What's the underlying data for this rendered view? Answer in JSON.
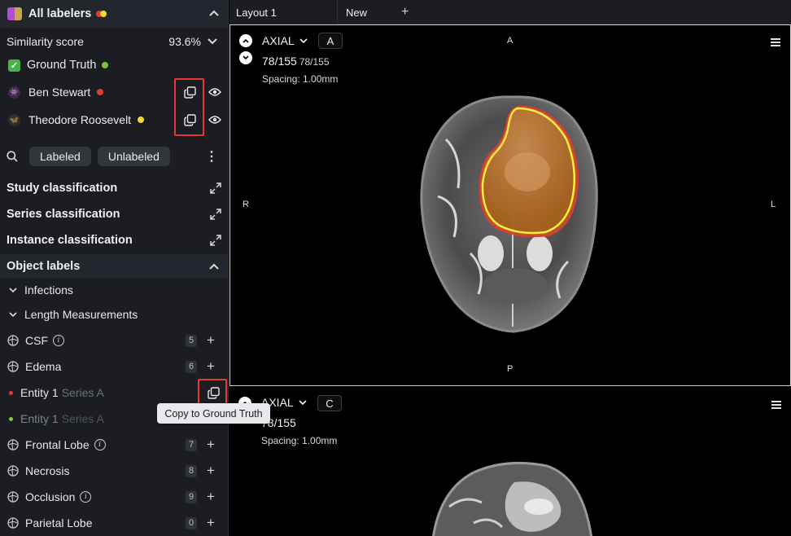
{
  "sidebar": {
    "header": {
      "title": "All labelers",
      "dot_colors": [
        "#e53935",
        "#fdd835"
      ]
    },
    "similarity": {
      "label": "Similarity score",
      "value": "93.6%"
    },
    "ground_truth": {
      "label": "Ground Truth",
      "dot_color": "#7cc242"
    },
    "labelers": [
      {
        "name": "Ben Stewart",
        "dot_color": "#e53935"
      },
      {
        "name": "Theodore Roosevelt",
        "dot_color": "#fdd835"
      }
    ],
    "filters": {
      "labeled": "Labeled",
      "unlabeled": "Unlabeled"
    },
    "classifications": [
      {
        "label": "Study classification"
      },
      {
        "label": "Series classification"
      },
      {
        "label": "Instance classification"
      }
    ],
    "object_labels": {
      "title": "Object labels",
      "groups": [
        {
          "label": "Infections"
        },
        {
          "label": "Length Measurements"
        }
      ],
      "items": [
        {
          "label": "CSF",
          "count": "5",
          "info": true
        },
        {
          "label": "Edema",
          "count": "6",
          "info": false
        },
        {
          "label": "Frontal Lobe",
          "count": "7",
          "info": true
        },
        {
          "label": "Necrosis",
          "count": "8",
          "info": false
        },
        {
          "label": "Occlusion",
          "count": "9",
          "info": true
        },
        {
          "label": "Parietal Lobe",
          "count": "0",
          "info": false
        }
      ],
      "entities": [
        {
          "label": "Entity 1",
          "series": "Series A",
          "dot_color": "#e53935"
        },
        {
          "label": "Entity 1",
          "series": "Series A",
          "dot_color": "#8bc34a"
        }
      ]
    },
    "tooltip": "Copy to Ground Truth"
  },
  "tabs": {
    "layout": "Layout 1",
    "new": "New"
  },
  "viewports": [
    {
      "plane": "AXIAL",
      "badge": "A",
      "slice": "78/155",
      "slice_small": "78/155",
      "spacing": "Spacing: 1.00mm",
      "orient": {
        "top": "A",
        "bottom": "P",
        "left": "R",
        "right": "L"
      }
    },
    {
      "plane": "AXIAL",
      "badge": "C",
      "slice": "78/155",
      "spacing": "Spacing: 1.00mm"
    }
  ],
  "colors": {
    "highlight": "#e53935",
    "accent_green": "#4caf50",
    "segmentation_fill": "#b36a22"
  }
}
